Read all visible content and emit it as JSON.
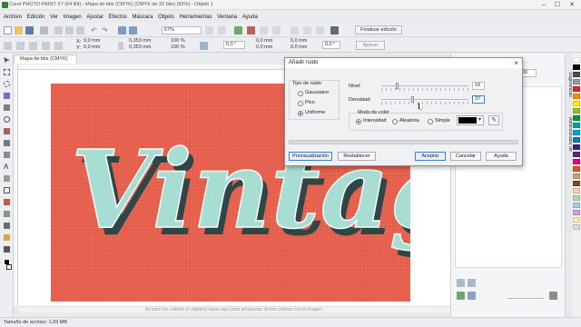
{
  "window": {
    "title": "Corel PHOTO-PAINT X7 (64 Bit) - Mapa de bits (CMYK) (CMYK de 32 bits) (82%) - Objeto 1",
    "minimize": "–",
    "maximize": "☐",
    "close": "✕"
  },
  "menu": [
    "Archivo",
    "Edición",
    "Ver",
    "Imagen",
    "Ajustar",
    "Efectos",
    "Máscara",
    "Objeto",
    "Herramientas",
    "Ventana",
    "Ayuda"
  ],
  "toolbar": {
    "zoom_value": "67%",
    "finalize_label": "Finalizar edición",
    "apply_label": "Aplicar"
  },
  "property_bar": {
    "x_label": "X:",
    "x_value": "0,0 mm",
    "y_label": "Y:",
    "y_value": "0,0 mm",
    "width_value": "0,353 mm",
    "height_value": "0,353 mm",
    "scale_w": "100 %",
    "scale_h": "100 %",
    "rotate_value": "0,0 °",
    "skew_value": "0,0 °",
    "pos2_a": "0,0 mm",
    "pos2_b": "0,0 mm",
    "pos3_a": "0,0 mm",
    "pos3_b": "0,0 mm"
  },
  "document": {
    "tab_label": "Mapa de bits (CMYK)",
    "artwork_text": "Vintage",
    "hint": "Arrastre los colores (u objetos) hasta aquí para almacenar dichos colores con la imagen."
  },
  "status": {
    "file_size": "Tamaño de archivo: 1.03 MB"
  },
  "docker": {
    "zoom_value": "100",
    "tab_suggestions": "Sugerencias",
    "tab_object_manager": "Administrador de"
  },
  "dialog": {
    "title": "Añadir ruido",
    "noise_type_label": "Tipo de ruido",
    "noise_types": [
      "Gaussiano",
      "Pico",
      "Uniforme"
    ],
    "selected_noise_type": "Uniforme",
    "level_label": "Nivel:",
    "level_value": "18",
    "density_label": "Densidad:",
    "density_value": "37",
    "color_mode_label": "Modo de color",
    "color_modes": [
      "Intensidad",
      "Aleatoria",
      "Simple"
    ],
    "selected_color_mode": "Intensidad",
    "simple_color": "#000000",
    "buttons": {
      "preview": "Previsualización",
      "reset": "Restablecer",
      "ok": "Aceptar",
      "cancel": "Cancelar",
      "help": "Ayuda"
    }
  },
  "colors": {
    "artwork_bg": "#e6624f",
    "letter_fill": "#a8ddd3",
    "letter_outline": "#2e4746",
    "accent": "#3d7fd0"
  }
}
